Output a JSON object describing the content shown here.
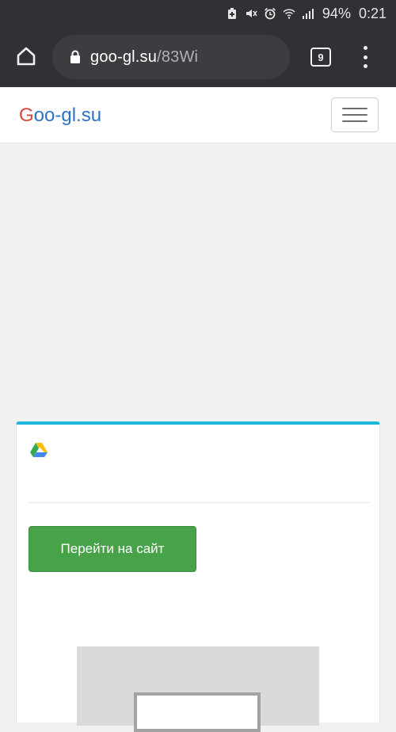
{
  "status_bar": {
    "battery": "94%",
    "time": "0:21",
    "icons": [
      "battery-saver-icon",
      "mute-icon",
      "alarm-icon",
      "wifi-icon",
      "signal-icon"
    ]
  },
  "browser": {
    "url_host": "goo-gl.su",
    "url_path": "/83Wi",
    "tab_count": "9",
    "icons": [
      "home-icon",
      "lock-icon",
      "tabs-icon",
      "more-vert-icon"
    ]
  },
  "site": {
    "brand_first": "G",
    "brand_rest": "oo-gl.su",
    "brand_colors": {
      "first": "#d9483b",
      "rest": "#2d73c5"
    }
  },
  "card": {
    "accent_color": "#1fb6dc",
    "button_label": "Перейти на сайт",
    "button_color": "#47a24a",
    "icon": "google-drive-icon"
  }
}
